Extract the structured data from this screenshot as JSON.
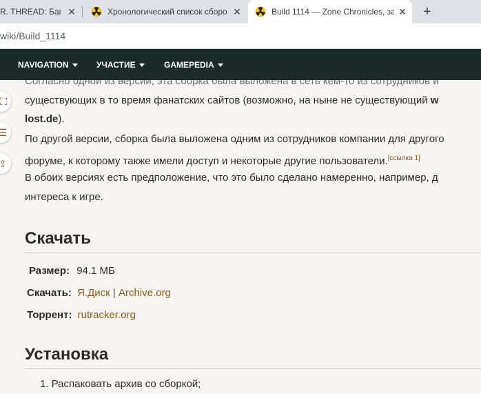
{
  "browser": {
    "tabs": [
      {
        "title": "R. THREAD: Баги"
      },
      {
        "title": "Хронологический список сборо"
      },
      {
        "title": "Build 1114 — Zone Chronicles, за"
      }
    ],
    "new_tab_label": "+",
    "close_glyph": "✕",
    "url": "wiki/Build_1114"
  },
  "nav": {
    "items": [
      {
        "label": "NAVIGATION"
      },
      {
        "label": "УЧАСТИЕ"
      },
      {
        "label": "GAMEPEDIA"
      }
    ]
  },
  "article": {
    "para1_line1": "Согласно одной из версий, эта сборка была выложена в сеть кем-то из сотрудников и",
    "para1_line2": "существующих в то время фанатских сайтов (возможно, на ныне не существующий ",
    "para1_line2_bold": "w",
    "para1_line3_bold": "lost.de",
    "para1_line3_tail": ").",
    "para2_line1": "По другой версии, сборка была выложена одним из сотрудников компании для другого",
    "para2_line2": "форуме, к которому также имели доступ и некоторые другие пользователи.",
    "para2_ref": "[ссылка 1]",
    "para3_line1": "В обоих версиях есть предположение, что это было сделано намеренно, например, д",
    "para3_line2": "интереса к игре.",
    "download_heading": "Скачать",
    "size_label": "Размер:",
    "size_value": "94.1 МБ",
    "download_label": "Скачать:",
    "download_link1": "Я.Диск",
    "download_sep": "|",
    "download_link2": "Archive.org",
    "torrent_label": "Торрент:",
    "torrent_link": "rutracker.org",
    "install_heading": "Установка",
    "install_step1": "1. Распаковать архив со сборкой;"
  },
  "colors": {
    "nav_bg": "#1c2b2a",
    "link": "#8a5a14",
    "page_bg": "#f6f5f3"
  }
}
